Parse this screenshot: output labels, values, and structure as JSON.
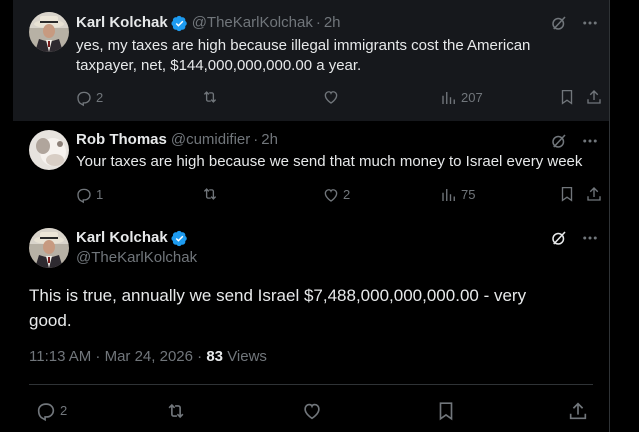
{
  "replies": [
    {
      "name": "Karl Kolchak",
      "handle": "@TheKarlKolchak",
      "time": "2h",
      "text_line1": "yes, my taxes are high because illegal immigrants cost the American",
      "text_line2": "taxpayer, net, $144,000,000,000.00 a year.",
      "replies": "2",
      "reposts": "",
      "likes": "",
      "views": "207",
      "verified": true
    },
    {
      "name": "Rob Thomas",
      "handle": "@cumidifier",
      "time": "2h",
      "text_line1": "Your taxes are high because we send that much money to Israel every week",
      "replies": "1",
      "reposts": "",
      "likes": "2",
      "views": "75",
      "verified": false
    }
  ],
  "main_post": {
    "name": "Karl Kolchak",
    "handle": "@TheKarlKolchak",
    "text_line1": "This is true, annually we send Israel $7,488,000,000,000.00 - very",
    "text_line2": "good.",
    "timestamp": "11:13 AM · Mar 24, 2026",
    "view_count": "83",
    "views_label": "Views",
    "replies": "2",
    "verified": true
  },
  "colors": {
    "background": "#000000",
    "highlight_background": "#16181c",
    "text": "#e7e9ea",
    "muted": "#71767b",
    "verified": "#1d9bf0",
    "border": "#2f3336"
  },
  "icons": [
    "verified-badge-icon",
    "grok-icon",
    "more-icon",
    "reply-icon",
    "repost-icon",
    "like-icon",
    "views-icon",
    "bookmark-icon",
    "share-icon"
  ]
}
